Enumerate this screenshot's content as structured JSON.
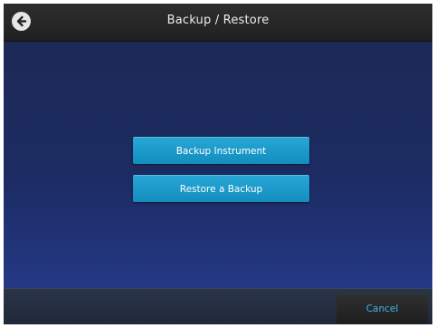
{
  "header": {
    "title": "Backup / Restore",
    "back_icon": "arrow-left-circle-icon"
  },
  "actions": {
    "backup_label": "Backup Instrument",
    "restore_label": "Restore a Backup"
  },
  "footer": {
    "cancel_label": "Cancel"
  },
  "colors": {
    "accent": "#1a9bd0",
    "cancel_text": "#3bb6ea",
    "titlebar": "#262626",
    "background": "#1c2b62"
  }
}
